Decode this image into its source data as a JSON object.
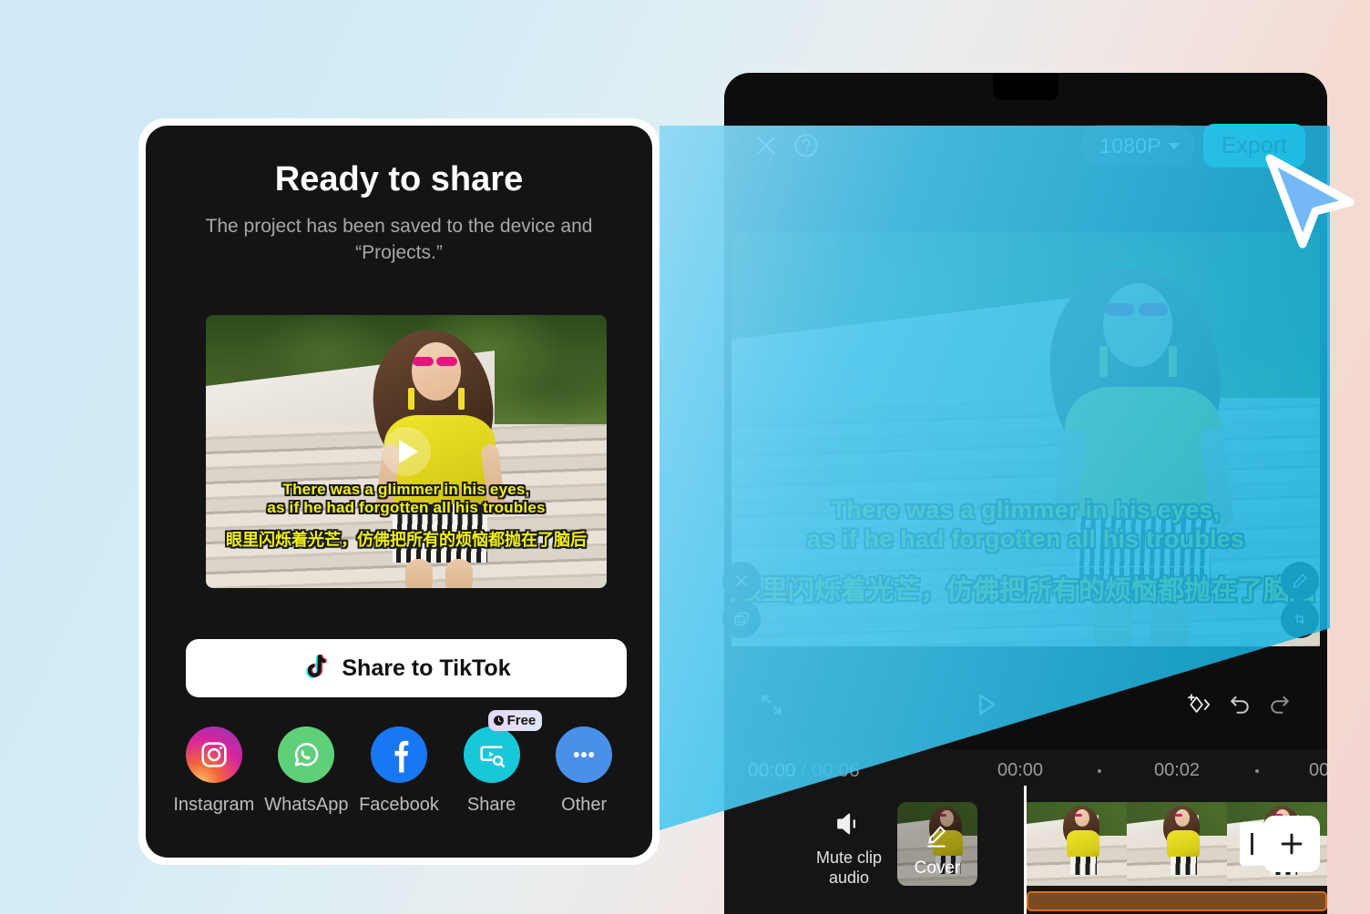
{
  "background": {
    "gradient_from": "#cfe9f7",
    "gradient_to": "#f2d5d2"
  },
  "share_dialog": {
    "title": "Ready to share",
    "subtitle": "The project has been saved to the device and “Projects.”",
    "play_icon": "play-icon",
    "primary_button": {
      "label": "Share to TikTok",
      "icon": "tiktok-icon"
    },
    "share_targets": [
      {
        "label": "Instagram",
        "icon": "instagram-icon",
        "color": "#d6249f",
        "badge": null
      },
      {
        "label": "WhatsApp",
        "icon": "whatsapp-icon",
        "color": "#5fd07a",
        "badge": null
      },
      {
        "label": "Facebook",
        "icon": "facebook-icon",
        "color": "#1877f2",
        "badge": null
      },
      {
        "label": "Share",
        "icon": "share-video-icon",
        "color": "#17c8d8",
        "badge": "Free"
      },
      {
        "label": "Other",
        "icon": "more-dots-icon",
        "color": "#4a90ea",
        "badge": null
      }
    ],
    "subtitles": {
      "en_line1": "There was a glimmer in his eyes,",
      "en_line2": "as if he had forgotten all his troubles",
      "zh": "眼里闪烁着光芒，仿佛把所有的烦恼都抛在了脑后",
      "color": "#f0f016"
    }
  },
  "editor": {
    "topbar": {
      "close_icon": "close-icon",
      "help_icon": "help-circle-icon",
      "resolution": "1080P",
      "resolution_caret": "chevron-down-icon",
      "export_label": "Export",
      "export_color": "#00cfe0"
    },
    "preview": {
      "subtitles": {
        "en_line1": "There was a glimmer in his eyes,",
        "en_line2": "as if he had forgotten all his troubles",
        "zh": "眼里闪烁着光芒，仿佛把所有的烦恼都抛在了脑后",
        "color": "#f0f016"
      },
      "handles": {
        "delete_icon": "close-icon",
        "copy_icon": "duplicate-icon",
        "edit_icon": "pencil-icon",
        "resize_icon": "resize-corner-icon"
      }
    },
    "toolbar": {
      "fullscreen_icon": "expand-icon",
      "play_icon": "play-icon",
      "keyframe_icon": "add-keyframe-icon",
      "undo_icon": "undo-icon",
      "redo_icon": "redo-icon"
    },
    "timeline": {
      "current_time": "00:00",
      "separator": "/",
      "total_time": "00:06",
      "ruler_marks": [
        "00:00",
        "00:02",
        "00"
      ],
      "mute_label_line1": "Mute clip",
      "mute_label_line2": "audio",
      "mute_icon": "speaker-mute-icon",
      "cover_label": "Cover",
      "cover_icon": "pencil-icon",
      "add_clip_icon": "plus-icon"
    }
  },
  "cursor": {
    "icon": "mouse-pointer-icon",
    "color": "#74b9f5"
  }
}
